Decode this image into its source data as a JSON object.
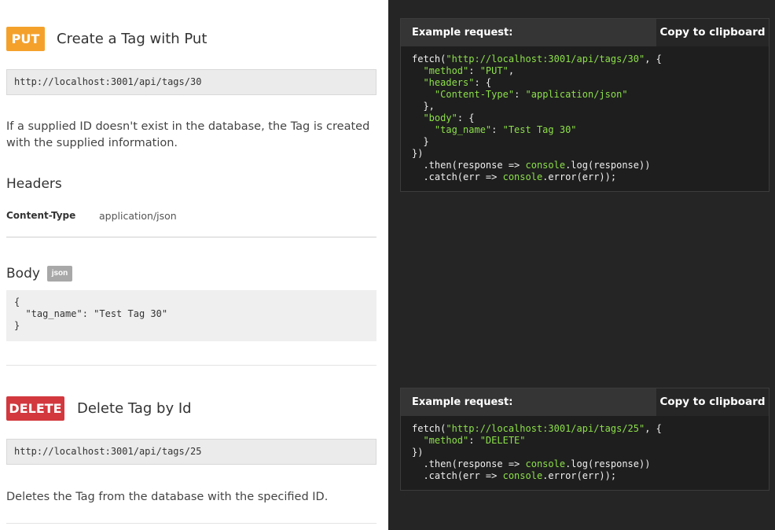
{
  "put_endpoint": {
    "method": "PUT",
    "title": "Create a Tag with Put",
    "url": "http://localhost:3001/api/tags/30",
    "description": "If a supplied ID doesn't exist in the database, the Tag is created with the supplied information.",
    "headers_heading": "Headers",
    "header_key": "Content-Type",
    "header_value": "application/json",
    "body_heading": "Body",
    "body_format": "json",
    "body_lines": [
      "{",
      "  \"tag_name\": \"Test Tag 30\"",
      "}"
    ]
  },
  "delete_endpoint": {
    "method": "DELETE",
    "title": "Delete Tag by Id",
    "url": "http://localhost:3001/api/tags/25",
    "description": "Deletes the Tag from the database with the specified ID."
  },
  "examples": {
    "label": "Example request:",
    "copy_label": "Copy to clipboard",
    "put": {
      "l1_a": "fetch(",
      "l1_url": "\"http://localhost:3001/api/tags/30\"",
      "l1_b": ", {",
      "method_key": "\"method\"",
      "method_val": "\"PUT\"",
      "headers_key": "\"headers\"",
      "ct_key": "\"Content-Type\"",
      "ct_val": "\"application/json\"",
      "body_key": "\"body\"",
      "tag_key": "\"tag_name\"",
      "tag_val": "\"Test Tag 30\""
    },
    "delete": {
      "l1_a": "fetch(",
      "l1_url": "\"http://localhost:3001/api/tags/25\"",
      "l1_b": ", {",
      "method_key": "\"method\"",
      "method_val": "\"DELETE\""
    },
    "then_a": "  .then(response => ",
    "console": "console",
    "then_b": ".log(response))",
    "catch_a": "  .catch(err => ",
    "catch_b": ".error(err));"
  },
  "colors": {
    "put": "#f4a12c",
    "delete": "#d2383e",
    "string": "#8de04a"
  }
}
